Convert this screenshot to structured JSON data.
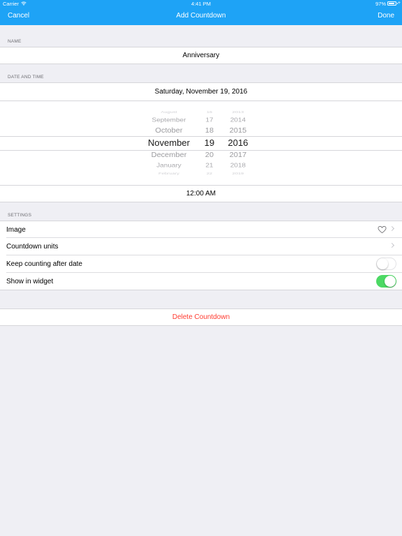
{
  "status_bar": {
    "carrier": "Carrier",
    "time": "4:41 PM",
    "battery_percent": "97%"
  },
  "nav_bar": {
    "cancel_label": "Cancel",
    "title": "Add Countdown",
    "done_label": "Done",
    "color": "#1ea3f6"
  },
  "name_section": {
    "header": "NAME",
    "value": "Anniversary"
  },
  "date_section": {
    "header": "DATE AND TIME",
    "display": "Saturday, November 19, 2016",
    "time": "12:00 AM"
  },
  "picker": {
    "months": [
      "August",
      "September",
      "October",
      "November",
      "December",
      "January",
      "February"
    ],
    "days": [
      "16",
      "17",
      "18",
      "19",
      "20",
      "21",
      "22"
    ],
    "years": [
      "2013",
      "2014",
      "2015",
      "2016",
      "2017",
      "2018",
      "2019"
    ],
    "selected_index": 3
  },
  "settings_section": {
    "header": "SETTINGS",
    "rows": [
      {
        "label": "Image",
        "icon": "heart-icon"
      },
      {
        "label": "Countdown units"
      },
      {
        "label": "Keep counting after date",
        "toggle_on": false
      },
      {
        "label": "Show in widget",
        "toggle_on": true
      }
    ]
  },
  "delete": {
    "label": "Delete Countdown",
    "color": "#ff3b30"
  }
}
